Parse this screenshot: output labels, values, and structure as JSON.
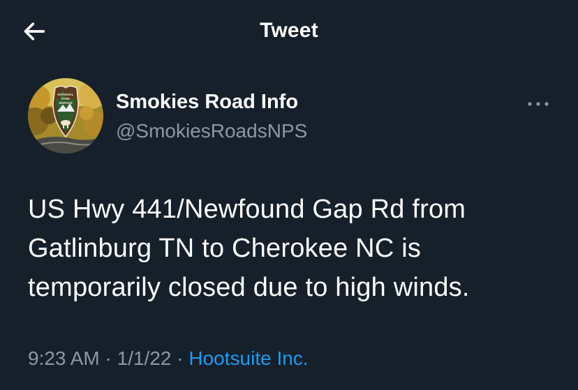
{
  "header": {
    "title": "Tweet",
    "back_icon": "arrow-left-icon"
  },
  "author": {
    "display_name": "Smokies Road Info",
    "handle": "@SmokiesRoadsNPS",
    "avatar_icon": "nps-arrowhead-logo",
    "avatar_logo_text": "NATIONAL PARK SERVICE"
  },
  "more_icon": "more-horizontal-icon",
  "tweet": {
    "text": "US Hwy 441/Newfound Gap Rd from\nGatlinburg TN to Cherokee NC is\ntemporarily closed due to high winds.",
    "time": "9:23 AM",
    "date": "1/1/22",
    "separator": "·",
    "source": "Hootsuite Inc."
  },
  "colors": {
    "background": "#15202b",
    "secondary_text": "#8b98a5",
    "link": "#1d9bf0"
  }
}
